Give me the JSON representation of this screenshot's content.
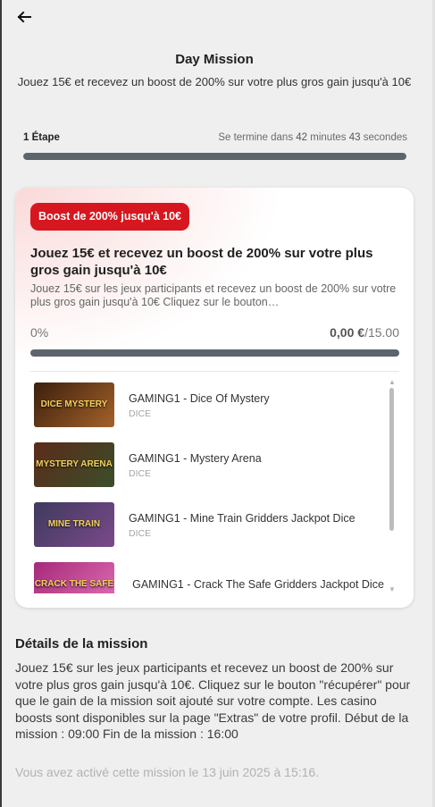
{
  "header": {
    "back_icon": "arrow-left-icon",
    "title": "Day Mission",
    "subtitle": "Jouez 15€ et recevez un boost de 200% sur votre plus gros gain jusqu'à 10€"
  },
  "progress": {
    "step_label": "1 Étape",
    "timer_prefix": "Se termine dans",
    "timer_minutes": "42",
    "timer_minutes_unit": "minutes",
    "timer_seconds": "43",
    "timer_seconds_unit": "secondes",
    "fill_fraction": 1.0
  },
  "mission_card": {
    "badge": "Boost de 200% jusqu'à 10€",
    "badge_color": "#d7171f",
    "title": "Jouez 15€ et recevez un boost de 200% sur votre plus gros gain jusqu'à 10€",
    "description": "Jouez 15€ sur les jeux participants et recevez un boost de 200% sur votre plus gros gain jusqu'à 10€ Cliquez sur le bouton…",
    "percent": "0%",
    "current_amount": "0,00 €",
    "target_amount": "/15.00",
    "progress_fraction": 0.0
  },
  "games": [
    {
      "name": "GAMING1 - Dice Of Mystery",
      "provider": "DICE",
      "thumb_text": "DICE MYSTERY",
      "thumb_colors": [
        "#3b1f0d",
        "#a4622a"
      ]
    },
    {
      "name": "GAMING1 - Mystery Arena",
      "provider": "DICE",
      "thumb_text": "MYSTERY ARENA",
      "thumb_colors": [
        "#5c2b1a",
        "#3a4e2a"
      ]
    },
    {
      "name": "GAMING1 - Mine Train Gridders Jackpot Dice",
      "provider": "DICE",
      "thumb_text": "MINE TRAIN",
      "thumb_colors": [
        "#3f3a5e",
        "#7a4a8a"
      ]
    },
    {
      "name": "GAMING1 - Crack The Safe Gridders Jackpot Dice",
      "provider": "",
      "thumb_text": "CRACK THE SAFE",
      "thumb_colors": [
        "#a52a7a",
        "#e06fb4"
      ]
    }
  ],
  "details": {
    "title": "Détails de la mission",
    "body": "Jouez 15€ sur les jeux participants et recevez un boost de 200% sur votre plus gros gain jusqu'à 10€. Cliquez sur le bouton \"récupérer\" pour que le gain de la mission soit ajouté sur votre compte. Les casino boosts sont disponibles sur la page \"Extras\" de votre profil. Début de la mission : 09:00 Fin de la mission : 16:00",
    "activated": "Vous avez activé cette mission le 13 juin 2025 à 15:16."
  }
}
